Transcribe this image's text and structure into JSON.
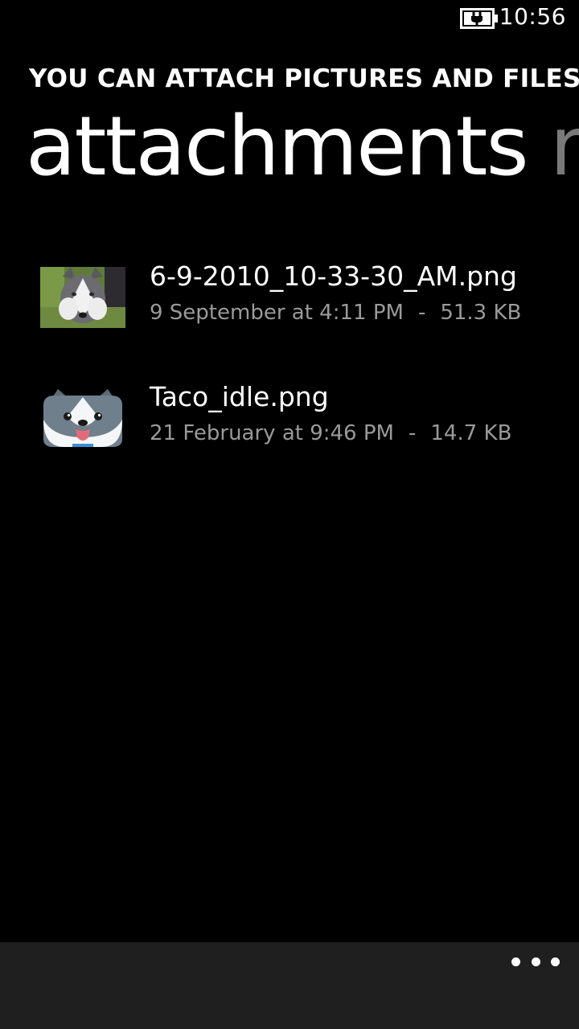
{
  "status_bar": {
    "time": "10:56",
    "battery_icon": "battery-charging-icon"
  },
  "header": {
    "app_title": "YOU CAN ATTACH PICTURES AND FILES...",
    "pivot_active": "attachments",
    "pivot_next": "m"
  },
  "files": [
    {
      "name": "6-9-2010_10-33-30_AM.png",
      "date": "9 September at 4:11 PM",
      "separator": "-",
      "size": "51.3 KB",
      "thumbnail": "husky-photo-thumbnail"
    },
    {
      "name": "Taco_idle.png",
      "date": "21 February at 9:46 PM",
      "separator": "-",
      "size": "14.7 KB",
      "thumbnail": "husky-cartoon-thumbnail"
    }
  ],
  "app_bar": {
    "more_icon": "ellipsis-icon"
  },
  "colors": {
    "background": "#000000",
    "app_bar": "#1f1f1f",
    "secondary_text": "#9a9a9a",
    "inactive_pivot": "#7a7a7a"
  }
}
